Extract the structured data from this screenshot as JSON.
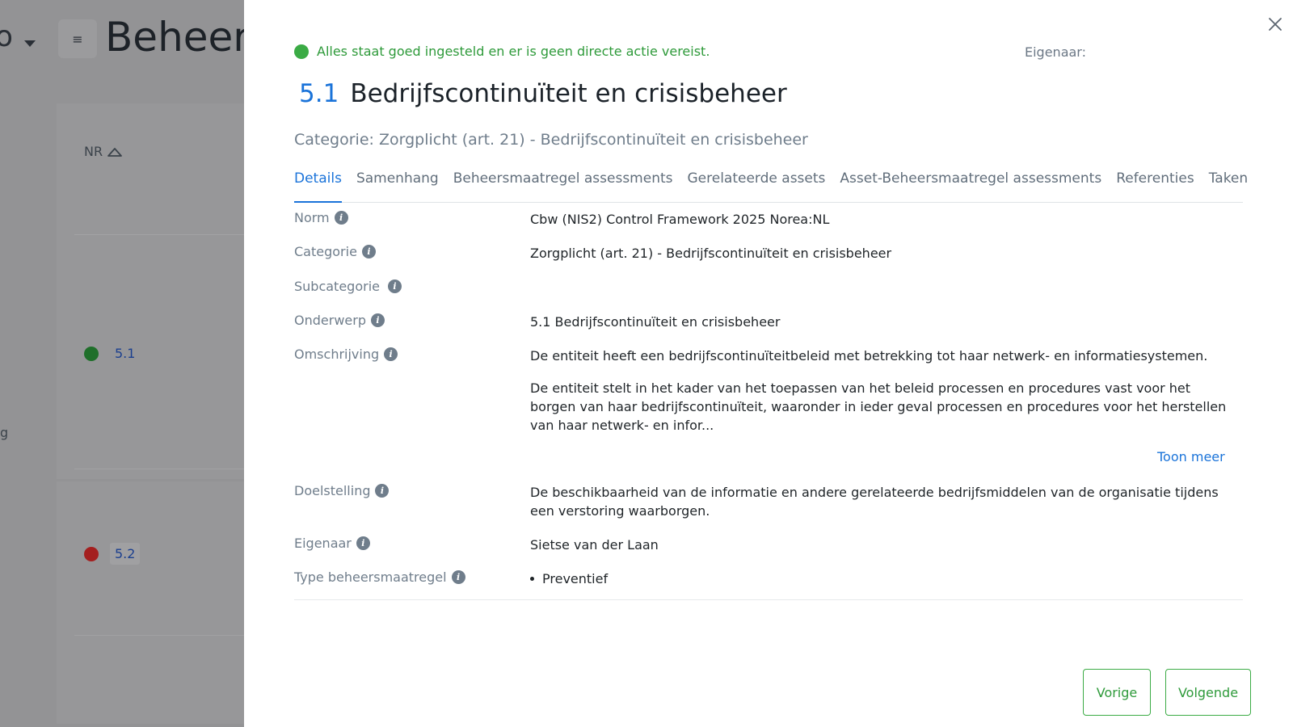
{
  "background": {
    "dropdown_text": "o",
    "menu_icon": "hamburger-icon",
    "page_title": "Beheers",
    "column_header": "NR",
    "rows": [
      {
        "nr": "5.1",
        "status_color": "#1f6f2a"
      },
      {
        "nr": "5.2",
        "status_color": "#a41f1f"
      }
    ],
    "side_fragment": "g"
  },
  "drawer": {
    "status": {
      "color": "#3bab45",
      "text": "Alles staat goed ingesteld en er is geen directe actie vereist."
    },
    "owner_label": "Eigenaar:",
    "number": "5.1",
    "title": "Bedrijfscontinuïteit en crisisbeheer",
    "category_line": "Categorie: Zorgplicht (art. 21) - Bedrijfscontinuïteit en crisisbeheer",
    "tabs": [
      {
        "label": "Details",
        "active": true
      },
      {
        "label": "Samenhang",
        "active": false
      },
      {
        "label": "Beheersmaatregel assessments",
        "active": false
      },
      {
        "label": "Gerelateerde assets",
        "active": false
      },
      {
        "label": "Asset-Beheersmaatregel assessments",
        "active": false
      },
      {
        "label": "Referenties",
        "active": false
      },
      {
        "label": "Taken",
        "active": false
      }
    ],
    "details": {
      "norm": {
        "label": "Norm",
        "value": "Cbw (NIS2) Control Framework 2025 Norea:NL"
      },
      "categorie": {
        "label": "Categorie",
        "value": "Zorgplicht (art. 21) - Bedrijfscontinuïteit en crisisbeheer"
      },
      "subcategorie": {
        "label": "Subcategorie",
        "value": ""
      },
      "onderwerp": {
        "label": "Onderwerp",
        "value": "5.1 Bedrijfscontinuïteit en crisisbeheer"
      },
      "omschrijving": {
        "label": "Omschrijving",
        "paragraph1": "De entiteit heeft een bedrijfscontinuïteitbeleid met betrekking tot haar netwerk- en informatiesystemen.",
        "paragraph2": "De entiteit stelt in het kader van het toepassen van het beleid processen en procedures vast voor het borgen van haar bedrijfscontinuïteit, waaronder in ieder geval processen en procedures voor het herstellen van haar netwerk- en infor..."
      },
      "show_more": "Toon meer",
      "doelstelling": {
        "label": "Doelstelling",
        "value": "De beschikbaarheid van de informatie en andere gerelateerde bedrijfsmiddelen van de organisatie tijdens een verstoring waarborgen."
      },
      "eigenaar": {
        "label": "Eigenaar",
        "value": "Sietse van der Laan"
      },
      "type": {
        "label": "Type beheersmaatregel",
        "values": [
          "Preventief"
        ]
      }
    },
    "buttons": {
      "previous": "Vorige",
      "next": "Volgende"
    },
    "icons": {
      "close": "close-icon",
      "info": "info-icon"
    }
  }
}
